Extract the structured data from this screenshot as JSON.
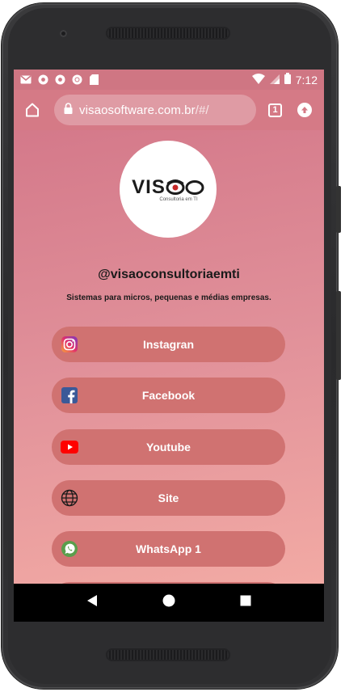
{
  "status": {
    "time": "7:12",
    "left_icons": [
      "gmail-icon",
      "chrome-icon",
      "chrome-icon",
      "circle-icon",
      "sd-card-icon"
    ]
  },
  "browser": {
    "url_main": "visaosoftware.com.br",
    "url_rest": "/#/",
    "tab_count": "1"
  },
  "profile": {
    "logo_text": "VIS",
    "logo_sub": "Consultoria em TI",
    "username": "@visaoconsultoriaemti",
    "tagline": "Sistemas para micros, pequenas e médias empresas."
  },
  "links": [
    {
      "label": "Instagran",
      "icon": "instagram-icon"
    },
    {
      "label": "Facebook",
      "icon": "facebook-icon"
    },
    {
      "label": "Youtube",
      "icon": "youtube-icon"
    },
    {
      "label": "Site",
      "icon": "globe-icon"
    },
    {
      "label": "WhatsApp 1",
      "icon": "whatsapp-icon"
    }
  ],
  "colors": {
    "status_bar": "#cf7683",
    "url_bar": "#d57a86",
    "button": "#d07271",
    "gradient_top": "#d4798a",
    "gradient_bottom": "#f2aaa4"
  }
}
